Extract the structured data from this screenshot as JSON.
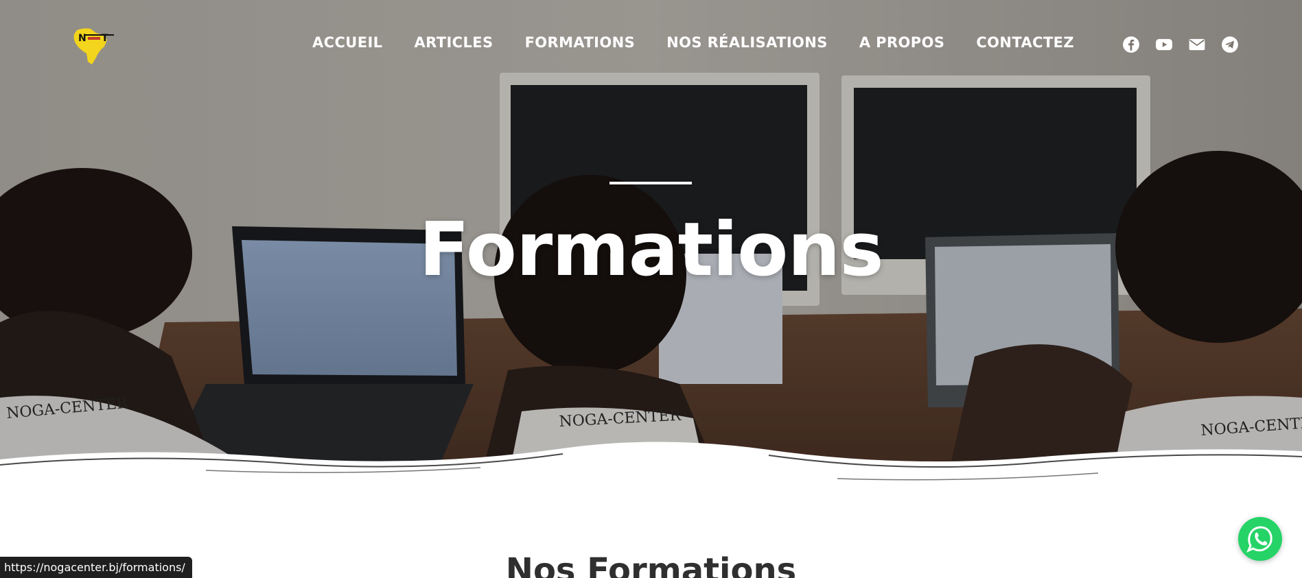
{
  "header": {
    "logo_alt": "Noga Center logo",
    "nav": [
      {
        "label": "ACCUEIL"
      },
      {
        "label": "ARTICLES"
      },
      {
        "label": "FORMATIONS"
      },
      {
        "label": "NOS RÉALISATIONS"
      },
      {
        "label": "A PROPOS"
      },
      {
        "label": "CONTACTEZ"
      }
    ],
    "social": [
      {
        "icon": "facebook-icon"
      },
      {
        "icon": "youtube-icon"
      },
      {
        "icon": "envelope-icon"
      },
      {
        "icon": "telegram-icon"
      }
    ]
  },
  "hero": {
    "title": "Formations",
    "shirt_text": "NOGA-CENTER"
  },
  "section": {
    "title": "Nos Formations"
  },
  "fab": {
    "icon": "whatsapp-icon",
    "color": "#25d366"
  },
  "status_bar": {
    "url": "https://nogacenter.bj/formations/"
  }
}
